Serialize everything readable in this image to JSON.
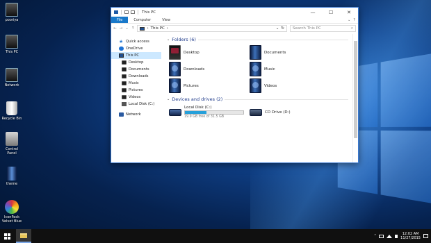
{
  "desktop": {
    "icons": [
      {
        "label": "pooriya",
        "icon": "computer-icon"
      },
      {
        "label": "This PC",
        "icon": "this-pc-icon"
      },
      {
        "label": "Network",
        "icon": "network-icon"
      },
      {
        "label": "Recycle Bin",
        "icon": "recycle-bin-icon"
      },
      {
        "label": "Control Panel",
        "icon": "control-panel-icon"
      },
      {
        "label": "theme",
        "icon": "theme-icon"
      },
      {
        "label": "IconPack Velvet Blue",
        "icon": "iconpack-icon"
      }
    ]
  },
  "window": {
    "title": "This PC",
    "controls": {
      "minimize": "—",
      "maximize": "☐",
      "close": "✕"
    },
    "ribbon_tabs": [
      "File",
      "Computer",
      "View"
    ],
    "address": {
      "back": "←",
      "forward": "→",
      "dropdown": "⌄",
      "up": "↑",
      "crumb": "This PC",
      "crumb_sep": "›",
      "refresh": "↻",
      "search_placeholder": "Search This PC",
      "search_glyph": "⌕"
    },
    "nav": {
      "quick_access": "Quick access",
      "onedrive": "OneDrive",
      "this_pc": "This PC",
      "items": [
        "Desktop",
        "Documents",
        "Downloads",
        "Music",
        "Pictures",
        "Videos",
        "Local Disk (C:)"
      ],
      "network": "Network"
    },
    "folders_header": "Folders (6)",
    "folders": [
      "Desktop",
      "Documents",
      "Downloads",
      "Music",
      "Pictures",
      "Videos"
    ],
    "drives_header": "Devices and drives (2)",
    "drives": [
      {
        "name": "Local Disk (C:)",
        "free_text": "19.9 GB free of 31.5 GB",
        "used_fraction": 0.37
      },
      {
        "name": "CD Drive (D:)"
      }
    ]
  },
  "taskbar": {
    "time": "12:02 AM",
    "date": "11/27/2015"
  },
  "colors": {
    "accent": "#1979ca",
    "selection": "#cce8ff",
    "drive_fill": "#26a0da",
    "header_text": "#1e3a8a"
  }
}
